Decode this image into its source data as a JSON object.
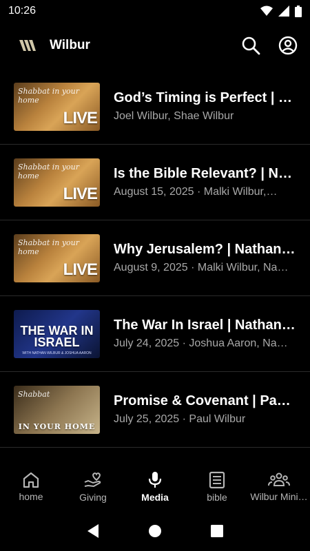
{
  "status": {
    "time": "10:26"
  },
  "header": {
    "app_title": "Wilbur"
  },
  "media": [
    {
      "title": "God’s Timing is Perfect  |  …",
      "subtitle": "Joel Wilbur, Shae Wilbur",
      "thumb_text": "LIVE",
      "thumb_script": "Shabbat in your home"
    },
    {
      "title": "Is the Bible Relevant? | Na…",
      "subtitle": "August 15, 2025 · Malki Wilbur,…",
      "thumb_text": "LIVE",
      "thumb_script": "Shabbat in your home"
    },
    {
      "title": "Why Jerusalem? | Nathan …",
      "subtitle": "August 9, 2025 · Malki Wilbur, Na…",
      "thumb_text": "LIVE",
      "thumb_script": "Shabbat in your home"
    },
    {
      "title": "The War In Israel | Nathan…",
      "subtitle": "July 24, 2025 · Joshua Aaron, Na…",
      "thumb_text": "THE WAR IN ISRAEL",
      "thumb_sub": "WITH NATHAN WILBUR & JOSHUA AARON"
    },
    {
      "title": "Promise & Covenant | Pau…",
      "subtitle": "July 25, 2025 · Paul Wilbur",
      "thumb_text": "IN YOUR HOME",
      "thumb_script": "Shabbat"
    }
  ],
  "nav": [
    {
      "label": "home",
      "icon": "home-icon"
    },
    {
      "label": "Giving",
      "icon": "giving-icon"
    },
    {
      "label": "Media",
      "icon": "microphone-icon",
      "active": true
    },
    {
      "label": "bible",
      "icon": "bible-icon"
    },
    {
      "label": "Wilbur Mini…",
      "icon": "community-icon"
    }
  ],
  "colors": {
    "background": "#000000",
    "text": "#ffffff",
    "muted": "#a9a9a9",
    "divider": "#2b2b2b"
  }
}
